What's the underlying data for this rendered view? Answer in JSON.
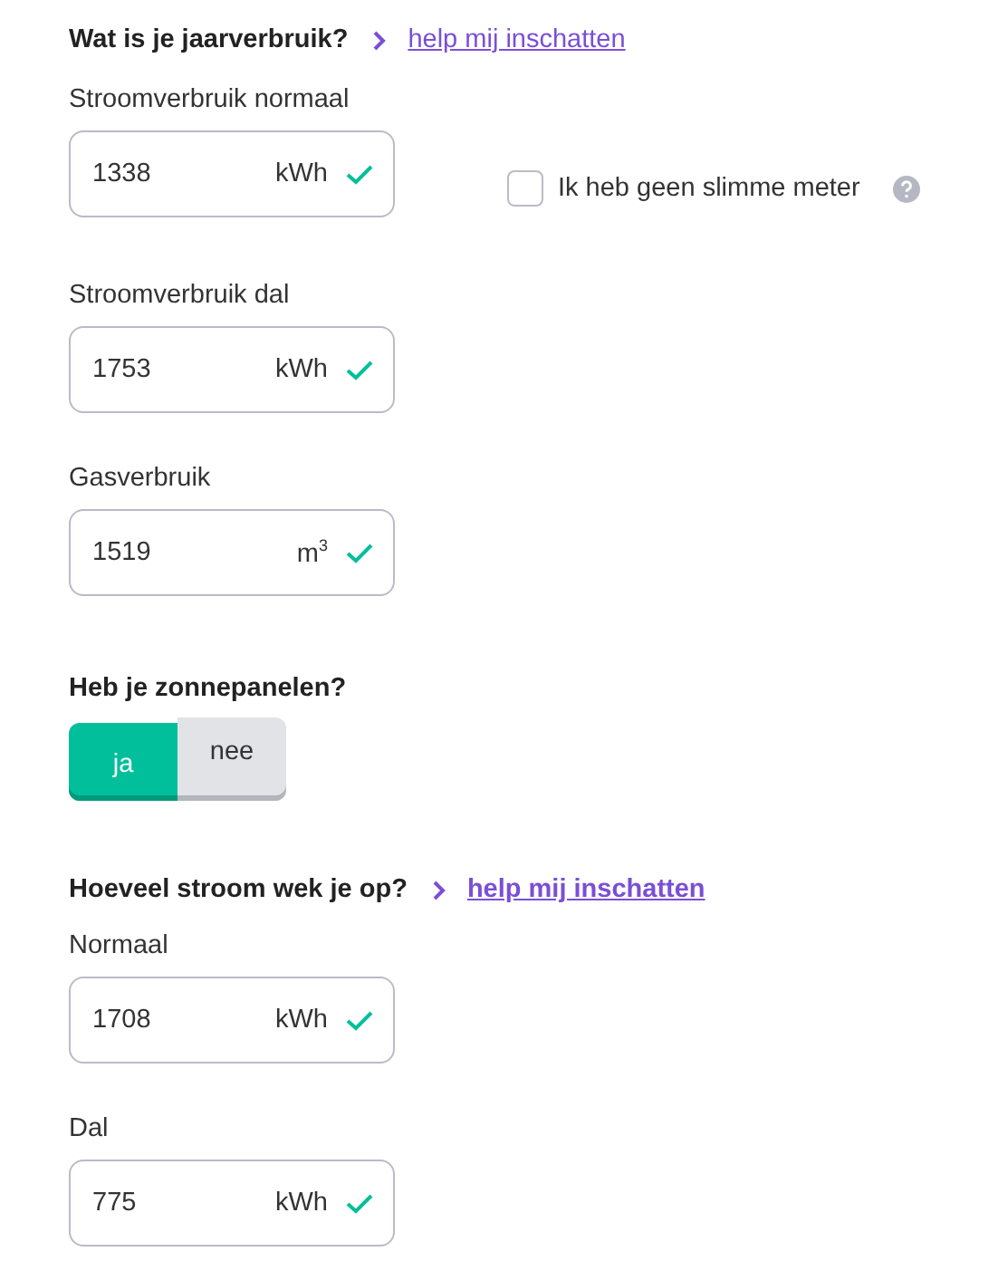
{
  "usage": {
    "heading": "Wat is je jaarverbruik?",
    "help_link": "help mij inschatten",
    "fields": [
      {
        "label": "Stroomverbruik normaal",
        "value": "1338",
        "unit": "kWh",
        "valid": true
      },
      {
        "label": "Stroomverbruik dal",
        "value": "1753",
        "unit": "kWh",
        "valid": true
      },
      {
        "label": "Gasverbruik",
        "value": "1519",
        "unit": "m$^{3}$",
        "valid": true
      }
    ],
    "no_smart_meter": {
      "label": "Ik heb geen slimme meter",
      "checked": false
    }
  },
  "solar": {
    "heading": "Heb je zonnepanelen?",
    "options": [
      {
        "label": "ja",
        "selected": true
      },
      {
        "label": "nee",
        "selected": false
      }
    ]
  },
  "generation": {
    "heading": "Hoeveel stroom wek je op?",
    "help_link": "help mij inschatten",
    "fields": [
      {
        "label": "Normaal",
        "value": "1708",
        "unit": "kWh",
        "valid": true
      },
      {
        "label": "Dal",
        "value": "775",
        "unit": "kWh",
        "valid": true
      }
    ]
  }
}
